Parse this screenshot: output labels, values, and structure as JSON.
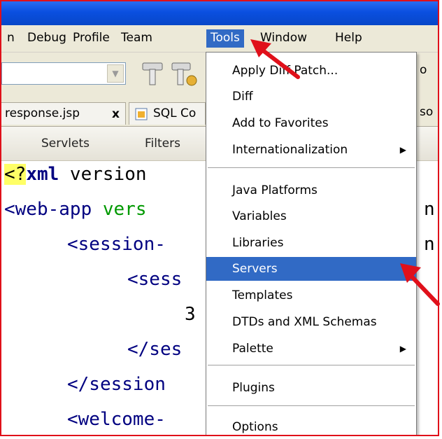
{
  "menubar": {
    "items": [
      "n",
      "Debug",
      "Profile",
      "Team",
      "Tools",
      "Window",
      "Help"
    ]
  },
  "tabs": [
    {
      "label": "response.jsp",
      "close": "x"
    },
    {
      "label": "SQL Co"
    }
  ],
  "subtabs": [
    "Servlets",
    "Filters"
  ],
  "code": {
    "line1": {
      "hl": "<?",
      "kw": "xml",
      "rest": " version"
    },
    "line2": {
      "tag": "<web-app ",
      "attr": "vers"
    },
    "line3": {
      "tag": "<session-"
    },
    "line4": {
      "tag": "<sess"
    },
    "line5": {
      "text": "3"
    },
    "line6": {
      "tag": "</ses"
    },
    "line7": {
      "tag": "</session"
    },
    "line8": {
      "tag": "<welcome-"
    }
  },
  "tools_menu": {
    "items": [
      {
        "label": "Apply Diff Patch..."
      },
      {
        "label": "Diff"
      },
      {
        "label": "Add to Favorites"
      },
      {
        "label": "Internationalization",
        "submenu": "▶"
      },
      {
        "label": "Java Platforms"
      },
      {
        "label": "Variables"
      },
      {
        "label": "Libraries"
      },
      {
        "label": "Servers",
        "selected": true
      },
      {
        "label": "Templates"
      },
      {
        "label": "DTDs and XML Schemas"
      },
      {
        "label": "Palette",
        "submenu": "▶"
      },
      {
        "label": "Plugins"
      },
      {
        "label": "Options"
      }
    ]
  },
  "edge_text": {
    "r1": "n",
    "r2": "n",
    "r3": "o",
    "r4": "so"
  },
  "colors": {
    "accent": "#316ac5",
    "annotation_red": "#e0101a",
    "titlebar": "#0a4fe0"
  },
  "icons": [
    "combo-dropdown-arrow-icon",
    "hammer-tool-icon",
    "build-tool-icon",
    "sql-file-icon"
  ]
}
